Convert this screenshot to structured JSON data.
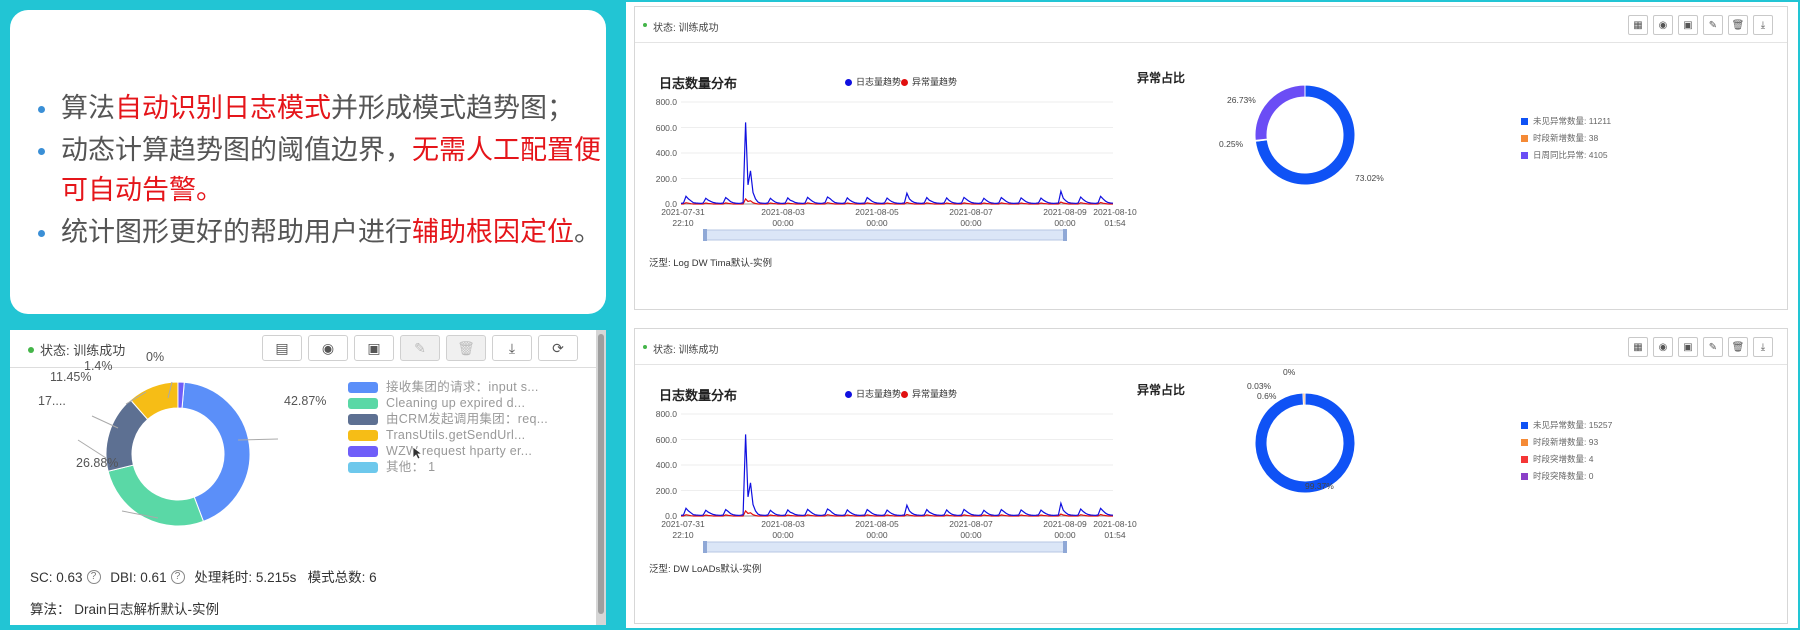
{
  "text_card": {
    "bullets": [
      {
        "parts": [
          {
            "t": "算法",
            "hl": false
          },
          {
            "t": "自动识别日志模式",
            "hl": true
          },
          {
            "t": "并形成模式趋势图；",
            "hl": false
          }
        ]
      },
      {
        "parts": [
          {
            "t": "动态计算趋势图的阈值边界，",
            "hl": false
          },
          {
            "t": "无需人工配置便可自动告警。",
            "hl": true
          }
        ]
      },
      {
        "parts": [
          {
            "t": "统计图形更好的帮助用户进行",
            "hl": false
          },
          {
            "t": "辅助根因定位",
            "hl": true
          },
          {
            "t": "。",
            "hl": false
          }
        ]
      }
    ],
    "highlight_color": "#e5151a"
  },
  "left_panel": {
    "status": "状态: 训练成功",
    "tools": [
      {
        "icon": "list-icon",
        "glyph": "▤",
        "disabled": false
      },
      {
        "icon": "eye-icon",
        "glyph": "◉",
        "disabled": false
      },
      {
        "icon": "save-icon",
        "glyph": "▣",
        "disabled": false
      },
      {
        "icon": "edit-icon",
        "glyph": "✎",
        "disabled": true
      },
      {
        "icon": "delete-icon",
        "glyph": "🗑",
        "disabled": true
      },
      {
        "icon": "download-icon",
        "glyph": "⤓",
        "disabled": false
      },
      {
        "icon": "refresh-icon",
        "glyph": "⟳",
        "disabled": false
      }
    ],
    "legend": [
      {
        "label": "接收集团的请求：input s...",
        "color": "#5b8ff9"
      },
      {
        "label": "Cleaning up expired d...",
        "color": "#5ad8a6"
      },
      {
        "label": "由CRM发起调用集团：req...",
        "color": "#5d7092"
      },
      {
        "label": "TransUtils.getSendUrl...",
        "color": "#f6bd16"
      },
      {
        "label": "WZW request hparty er...",
        "color": "#6f5ef9"
      },
      {
        "label": "其他：  1",
        "color": "#6dc8ec"
      }
    ],
    "pie_labels": [
      "42.87%",
      "26.88%",
      "17....",
      "11.45%",
      "1.4%",
      "0%"
    ],
    "metrics": {
      "sc": "SC: 0.63",
      "dbi": "DBI: 0.61",
      "time": "处理耗时: 5.215s",
      "total": "模式总数: 6"
    },
    "algorithm": "算法：  Drain日志解析默认-实例"
  },
  "panels": [
    {
      "status": "状态: 训练成功",
      "chart_title": "日志数量分布",
      "legend": [
        {
          "label": "日志量趋势",
          "color": "#1010e0"
        },
        {
          "label": "异常量趋势",
          "color": "#e01010"
        }
      ],
      "donut_title": "异常占比",
      "donut_labels": [
        "26.73%",
        "0.25%",
        "73.02%"
      ],
      "donut_legend": [
        {
          "label": "未见异常数量: 11211",
          "color": "#0f52f5"
        },
        {
          "label": "时段新增数量: 38",
          "color": "#f58a36"
        },
        {
          "label": "日周同比异常: 4105",
          "color": "#6b4df5"
        }
      ],
      "type_line": "泛型:  Log DW Tima默认-实例"
    },
    {
      "status": "状态: 训练成功",
      "chart_title": "日志数量分布",
      "legend": [
        {
          "label": "日志量趋势",
          "color": "#1010e0"
        },
        {
          "label": "异常量趋势",
          "color": "#e01010"
        }
      ],
      "donut_title": "异常占比",
      "donut_labels": [
        "0%",
        "0.03%",
        "0.6%",
        "99.37%"
      ],
      "donut_legend": [
        {
          "label": "未见异常数量: 15257",
          "color": "#0f52f5"
        },
        {
          "label": "时段新增数量: 93",
          "color": "#f58a36"
        },
        {
          "label": "时段突增数量: 4",
          "color": "#f53636"
        },
        {
          "label": "时段突降数量: 0",
          "color": "#8a3fc8"
        }
      ],
      "type_line": "泛型:  DW LoADs默认-实例"
    }
  ],
  "panel_tool_icons": [
    {
      "icon": "calculator-icon",
      "glyph": "▦"
    },
    {
      "icon": "eye-icon",
      "glyph": "◉"
    },
    {
      "icon": "save-icon",
      "glyph": "▣"
    },
    {
      "icon": "edit-icon",
      "glyph": "✎"
    },
    {
      "icon": "delete-icon",
      "glyph": "🗑"
    },
    {
      "icon": "download-icon",
      "glyph": "⤓"
    }
  ],
  "chart_data": [
    {
      "type": "pie",
      "categories": [
        "接收集团的请求：input s...",
        "Cleaning up expired d...",
        "由CRM发起调用集团：req...",
        "TransUtils.getSendUrl...",
        "WZW request hparty er...",
        "其他：  1"
      ],
      "values": [
        42.87,
        26.88,
        17.4,
        11.45,
        1.4,
        0
      ],
      "colors": [
        "#5b8ff9",
        "#5ad8a6",
        "#5d7092",
        "#f6bd16",
        "#6f5ef9",
        "#6dc8ec"
      ],
      "donut": true
    },
    {
      "type": "line",
      "title": "日志数量分布",
      "x_ticks": [
        "2021-07-31 22:10",
        "2021-08-03 00:00",
        "2021-08-05 00:00",
        "2021-08-07 00:00",
        "2021-08-09 00:00",
        "2021-08-10 01:54"
      ],
      "y_ticks": [
        "800.0",
        "600.0",
        "400.0",
        "200.0",
        "0.0"
      ],
      "ylim": [
        0,
        800
      ],
      "series": [
        {
          "name": "日志量趋势",
          "color": "#1010e0",
          "values": [
            5,
            8,
            60,
            40,
            25,
            10,
            8,
            6,
            5,
            9,
            45,
            30,
            20,
            12,
            8,
            6,
            5,
            8,
            50,
            35,
            18,
            10,
            7,
            5,
            6,
            10,
            640,
            150,
            260,
            90,
            40,
            15,
            8,
            6,
            5,
            9,
            45,
            28,
            15,
            9,
            6,
            5,
            8,
            48,
            30,
            22,
            12,
            8,
            6,
            5,
            9,
            52,
            35,
            20,
            10,
            7,
            5,
            6,
            10,
            55,
            42,
            25,
            12,
            8,
            6,
            5,
            9,
            48,
            30,
            18,
            10,
            7,
            5,
            6,
            8,
            50,
            35,
            20,
            12,
            8,
            6,
            5,
            9,
            46,
            30,
            18,
            10,
            7,
            5,
            6,
            9,
            85,
            40,
            22,
            12,
            8,
            6,
            5,
            9,
            50,
            30,
            20,
            12,
            8,
            6,
            5,
            9,
            48,
            28,
            15,
            9,
            6,
            5,
            8,
            52,
            36,
            22,
            12,
            8,
            6,
            5,
            9,
            45,
            28,
            15,
            9,
            6,
            5,
            8,
            50,
            35,
            20,
            10,
            7,
            5,
            6,
            8,
            48,
            32,
            18,
            10,
            7,
            5,
            6,
            9,
            46,
            30,
            18,
            10,
            7,
            5,
            6,
            8,
            100,
            45,
            25,
            12,
            8,
            6,
            5,
            9,
            55,
            35,
            20,
            12,
            8,
            6,
            5,
            9,
            60,
            40,
            22,
            12,
            8,
            6
          ]
        },
        {
          "name": "异常量趋势",
          "color": "#e01010",
          "values": [
            0,
            0,
            10,
            6,
            2,
            0,
            0,
            0,
            0,
            0,
            8,
            4,
            2,
            0,
            0,
            0,
            0,
            0,
            9,
            5,
            2,
            0,
            0,
            0,
            0,
            0,
            40,
            20,
            25,
            10,
            4,
            0,
            0,
            0,
            0,
            0,
            8,
            4,
            2,
            0,
            0,
            0,
            0,
            7,
            4,
            2,
            0,
            0,
            0,
            0,
            0,
            9,
            5,
            2,
            0,
            0,
            0,
            0,
            0,
            10,
            6,
            3,
            0,
            0,
            0,
            0,
            0,
            8,
            4,
            2,
            0,
            0,
            0,
            0,
            0,
            9,
            5,
            2,
            0,
            0,
            0,
            0,
            0,
            8,
            4,
            2,
            0,
            0,
            0,
            0,
            0,
            12,
            6,
            3,
            0,
            0,
            0,
            0,
            0,
            9,
            5,
            2,
            0,
            0,
            0,
            0,
            0,
            8,
            4,
            2,
            0,
            0,
            0,
            0,
            9,
            5,
            2,
            0,
            0,
            0,
            0,
            0,
            8,
            4,
            2,
            0,
            0,
            0,
            0,
            9,
            5,
            2,
            0,
            0,
            0,
            0,
            0,
            8,
            4,
            2,
            0,
            0,
            0,
            0,
            0,
            8,
            4,
            2,
            0,
            0,
            0,
            0,
            0,
            15,
            8,
            4,
            0,
            0,
            0,
            0,
            0,
            10,
            6,
            3,
            0,
            0,
            0,
            0,
            0,
            12,
            6,
            3,
            0,
            0,
            0
          ]
        }
      ]
    },
    {
      "type": "pie",
      "title": "异常占比",
      "categories": [
        "未见异常数量: 11211",
        "时段新增数量: 38",
        "日周同比异常: 4105"
      ],
      "values": [
        73.02,
        0.25,
        26.73
      ],
      "colors": [
        "#0f52f5",
        "#f58a36",
        "#6b4df5"
      ],
      "donut": true
    },
    {
      "type": "line",
      "title": "日志数量分布",
      "x_ticks": [
        "2021-07-31 22:10",
        "2021-08-03 00:00",
        "2021-08-05 00:00",
        "2021-08-07 00:00",
        "2021-08-09 00:00",
        "2021-08-10 01:54"
      ],
      "y_ticks": [
        "800.0",
        "600.0",
        "400.0",
        "200.0",
        "0.0"
      ],
      "ylim": [
        0,
        800
      ],
      "series": [
        {
          "name": "日志量趋势",
          "color": "#1010e0",
          "values": [
            5,
            8,
            60,
            40,
            25,
            10,
            8,
            6,
            5,
            9,
            45,
            30,
            20,
            12,
            8,
            6,
            5,
            8,
            50,
            35,
            18,
            10,
            7,
            5,
            6,
            10,
            640,
            150,
            260,
            90,
            40,
            15,
            8,
            6,
            5,
            9,
            45,
            28,
            15,
            9,
            6,
            5,
            8,
            48,
            30,
            22,
            12,
            8,
            6,
            5,
            9,
            52,
            35,
            20,
            10,
            7,
            5,
            6,
            10,
            55,
            42,
            25,
            12,
            8,
            6,
            5,
            9,
            48,
            30,
            18,
            10,
            7,
            5,
            6,
            8,
            50,
            35,
            20,
            12,
            8,
            6,
            5,
            9,
            46,
            30,
            18,
            10,
            7,
            5,
            6,
            9,
            85,
            40,
            22,
            12,
            8,
            6,
            5,
            9,
            50,
            30,
            20,
            12,
            8,
            6,
            5,
            9,
            48,
            28,
            15,
            9,
            6,
            5,
            8,
            52,
            36,
            22,
            12,
            8,
            6,
            5,
            9,
            45,
            28,
            15,
            9,
            6,
            5,
            8,
            50,
            35,
            20,
            10,
            7,
            5,
            6,
            8,
            48,
            32,
            18,
            10,
            7,
            5,
            6,
            9,
            46,
            30,
            18,
            10,
            7,
            5,
            6,
            8,
            100,
            45,
            25,
            12,
            8,
            6,
            5,
            9,
            55,
            35,
            20,
            12,
            8,
            6,
            5,
            9,
            60,
            40,
            22,
            12,
            8,
            6
          ]
        },
        {
          "name": "异常量趋势",
          "color": "#e01010",
          "values": [
            0,
            0,
            10,
            6,
            2,
            0,
            0,
            0,
            0,
            0,
            8,
            4,
            2,
            0,
            0,
            0,
            0,
            0,
            9,
            5,
            2,
            0,
            0,
            0,
            0,
            0,
            40,
            20,
            25,
            10,
            4,
            0,
            0,
            0,
            0,
            0,
            8,
            4,
            2,
            0,
            0,
            0,
            0,
            7,
            4,
            2,
            0,
            0,
            0,
            0,
            0,
            9,
            5,
            2,
            0,
            0,
            0,
            0,
            0,
            10,
            6,
            3,
            0,
            0,
            0,
            0,
            0,
            8,
            4,
            2,
            0,
            0,
            0,
            0,
            0,
            9,
            5,
            2,
            0,
            0,
            0,
            0,
            0,
            8,
            4,
            2,
            0,
            0,
            0,
            0,
            0,
            12,
            6,
            3,
            0,
            0,
            0,
            0,
            0,
            9,
            5,
            2,
            0,
            0,
            0,
            0,
            0,
            8,
            4,
            2,
            0,
            0,
            0,
            0,
            9,
            5,
            2,
            0,
            0,
            0,
            0,
            0,
            8,
            4,
            2,
            0,
            0,
            0,
            0,
            9,
            5,
            2,
            0,
            0,
            0,
            0,
            0,
            8,
            4,
            2,
            0,
            0,
            0,
            0,
            0,
            8,
            4,
            2,
            0,
            0,
            0,
            0,
            0,
            15,
            8,
            4,
            0,
            0,
            0,
            0,
            0,
            10,
            6,
            3,
            0,
            0,
            0,
            0,
            0,
            12,
            6,
            3,
            0,
            0,
            0
          ]
        }
      ]
    },
    {
      "type": "pie",
      "title": "异常占比",
      "categories": [
        "未见异常数量: 15257",
        "时段新增数量: 93",
        "时段突增数量: 4",
        "时段突降数量: 0"
      ],
      "values": [
        99.37,
        0.6,
        0.03,
        0
      ],
      "colors": [
        "#0f52f5",
        "#f58a36",
        "#f53636",
        "#8a3fc8"
      ],
      "donut": true
    }
  ]
}
